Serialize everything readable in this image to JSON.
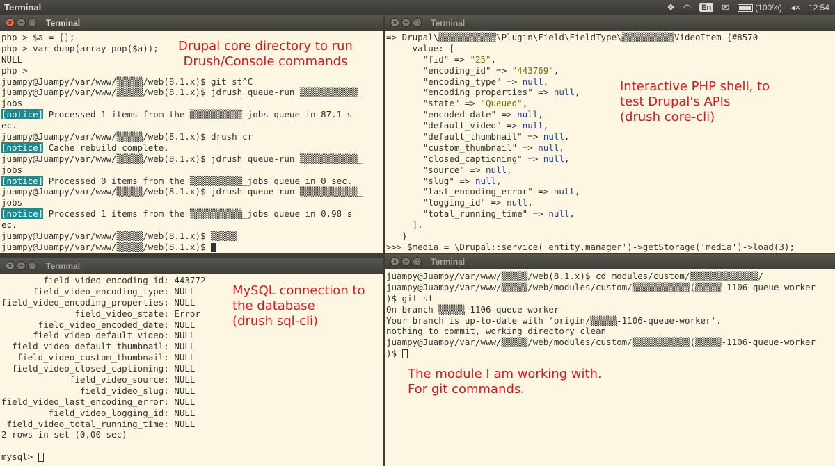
{
  "panel": {
    "title": "Terminal",
    "lang": "En",
    "battery": "(100%)",
    "clock": "12:54"
  },
  "windows": {
    "tl": {
      "title": "Terminal",
      "lines": [
        "php > $a = [];",
        "php > var_dump(array_pop($a));",
        "NULL",
        "php >",
        "juampy@Juampy/var/www/▒▒▒▒▒/web(8.1.x)$ git st^C",
        "juampy@Juampy/var/www/▒▒▒▒▒/web(8.1.x)$ jdrush queue-run ▒▒▒▒▒▒▒▒▒▒▒_",
        "jobs",
        "__NOTICE__ Processed 1 items from the ▒▒▒▒▒▒▒▒▒▒_jobs queue in 87.1 s",
        "ec.",
        "juampy@Juampy/var/www/▒▒▒▒▒/web(8.1.x)$ drush cr",
        "__NOTICE__ Cache rebuild complete.",
        "juampy@Juampy/var/www/▒▒▒▒▒/web(8.1.x)$ jdrush queue-run ▒▒▒▒▒▒▒▒▒▒▒_",
        "jobs",
        "__NOTICE__ Processed 0 items from the ▒▒▒▒▒▒▒▒▒▒_jobs queue in 0 sec.",
        "juampy@Juampy/var/www/▒▒▒▒▒/web(8.1.x)$ jdrush queue-run ▒▒▒▒▒▒▒▒▒▒▒_",
        "jobs",
        "__NOTICE__ Processed 1 items from the ▒▒▒▒▒▒▒▒▒▒_jobs queue in 0.98 s",
        "ec.",
        "juampy@Juampy/var/www/▒▒▒▒▒/web(8.1.x)$ ▒▒▒▒▒",
        "juampy@Juampy/var/www/▒▒▒▒▒/web(8.1.x)$ __CURSOR__"
      ],
      "notice_label": "[notice]",
      "annotation": "Drupal core directory to run\nDrush/Console commands"
    },
    "tr": {
      "title": "Terminal",
      "lines": [
        "=> Drupal\\▒▒▒▒▒▒▒▒▒▒▒\\Plugin\\Field\\FieldType\\▒▒▒▒▒▒▒▒▒▒VideoItem {#8570",
        "     value: [",
        "       \"fid\" => \"25\",",
        "       \"encoding_id\" => \"443769\",",
        "       \"encoding_type\" => null,",
        "       \"encoding_properties\" => null,",
        "       \"state\" => \"Queued\",",
        "       \"encoded_date\" => null,",
        "       \"default_video\" => null,",
        "       \"default_thumbnail\" => null,",
        "       \"custom_thumbnail\" => null,",
        "       \"closed_captioning\" => null,",
        "       \"source\" => null,",
        "       \"slug\" => null,",
        "       \"last_encoding_error\" => null,",
        "       \"logging_id\" => null,",
        "       \"total_running_time\" => null,",
        "     ],",
        "   }",
        ">>> $media = \\Drupal::service('entity.manager')->getStorage('media')->load(3);"
      ],
      "annotation": "Interactive PHP shell, to\ntest Drupal's APIs\n(drush core-cli)"
    },
    "bl": {
      "title": "Terminal",
      "lines": [
        "        field_video_encoding_id: 443772",
        "      field_video_encoding_type: NULL",
        "field_video_encoding_properties: NULL",
        "              field_video_state: Error",
        "       field_video_encoded_date: NULL",
        "      field_video_default_video: NULL",
        "  field_video_default_thumbnail: NULL",
        "   field_video_custom_thumbnail: NULL",
        "  field_video_closed_captioning: NULL",
        "             field_video_source: NULL",
        "               field_video_slug: NULL",
        "field_video_last_encoding_error: NULL",
        "         field_video_logging_id: NULL",
        " field_video_total_running_time: NULL",
        "2 rows in set (0,00 sec)",
        "",
        "mysql> __CURSOR__"
      ],
      "annotation": "MySQL connection to\nthe database\n(drush sql-cli)"
    },
    "br": {
      "title": "Terminal",
      "lines": [
        "juampy@Juampy/var/www/▒▒▒▒▒/web(8.1.x)$ cd modules/custom/▒▒▒▒▒▒▒▒▒▒▒▒▒/",
        "juampy@Juampy/var/www/▒▒▒▒▒/web/modules/custom/▒▒▒▒▒▒▒▒▒▒▒(▒▒▒▒▒-1106-queue-worker",
        ")$ git st",
        "On branch ▒▒▒▒▒-1106-queue-worker",
        "Your branch is up-to-date with 'origin/▒▒▒▒▒-1106-queue-worker'.",
        "nothing to commit, working directory clean",
        "juampy@Juampy/var/www/▒▒▒▒▒/web/modules/custom/▒▒▒▒▒▒▒▒▒▒▒(▒▒▒▒▒-1106-queue-worker",
        ")$ __CURSOR__"
      ],
      "annotation": "The module I am working with.\nFor git commands."
    }
  }
}
